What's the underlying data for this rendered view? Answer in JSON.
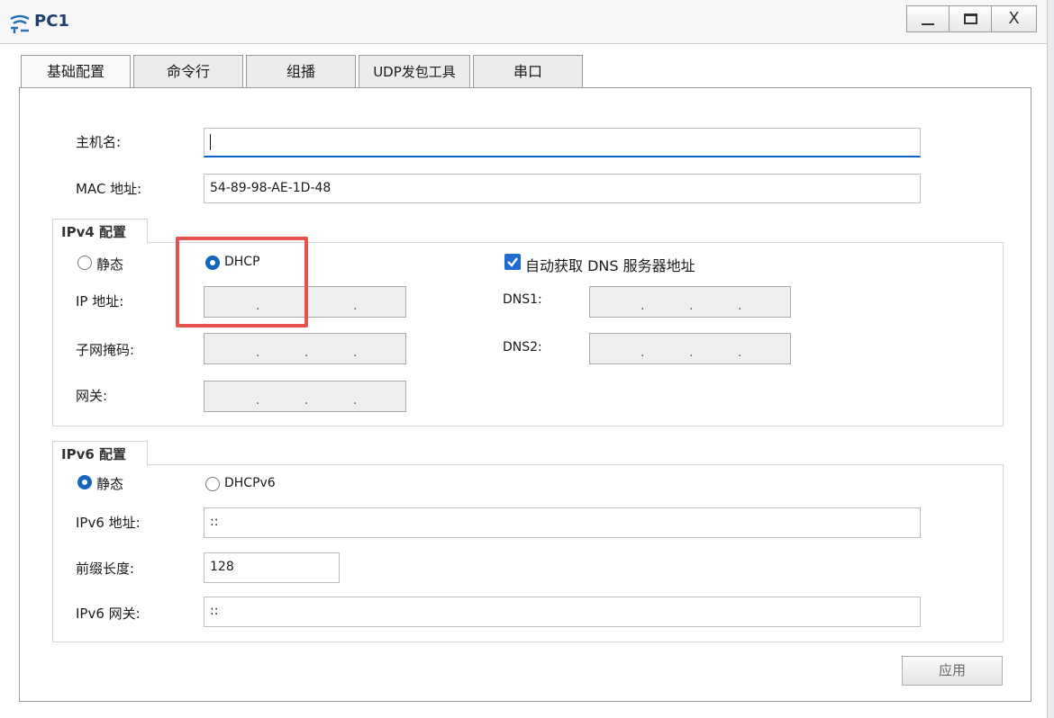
{
  "window": {
    "title": "PC1",
    "minimize_glyph": "_",
    "close_glyph": "X"
  },
  "tabs": [
    "基础配置",
    "命令行",
    "组播",
    "UDP发包工具",
    "串口"
  ],
  "basic": {
    "hostname_label": "主机名:",
    "hostname_value": "",
    "mac_label": "MAC 地址:",
    "mac_value": "54-89-98-AE-1D-48"
  },
  "ipv4": {
    "group_label": "IPv4 配置",
    "static_label": "静态",
    "dhcp_label": "DHCP",
    "selected_mode": "DHCP",
    "auto_dns_label": "自动获取 DNS 服务器地址",
    "auto_dns_checked": true,
    "ip_label": "IP 地址:",
    "mask_label": "子网掩码:",
    "gateway_label": "网关:",
    "dns1_label": "DNS1:",
    "dns2_label": "DNS2:",
    "octet_separator": "."
  },
  "ipv6": {
    "group_label": "IPv6 配置",
    "static_label": "静态",
    "dhcpv6_label": "DHCPv6",
    "selected_mode": "静态",
    "addr_label": "IPv6 地址:",
    "addr_value": "::",
    "prefix_label": "前缀长度:",
    "prefix_value": "128",
    "gateway_label": "IPv6 网关:",
    "gateway_value": "::"
  },
  "apply_label": "应用",
  "colors": {
    "accent": "#1565c0",
    "highlight": "#e8524e",
    "title": "#1f3d6d"
  }
}
